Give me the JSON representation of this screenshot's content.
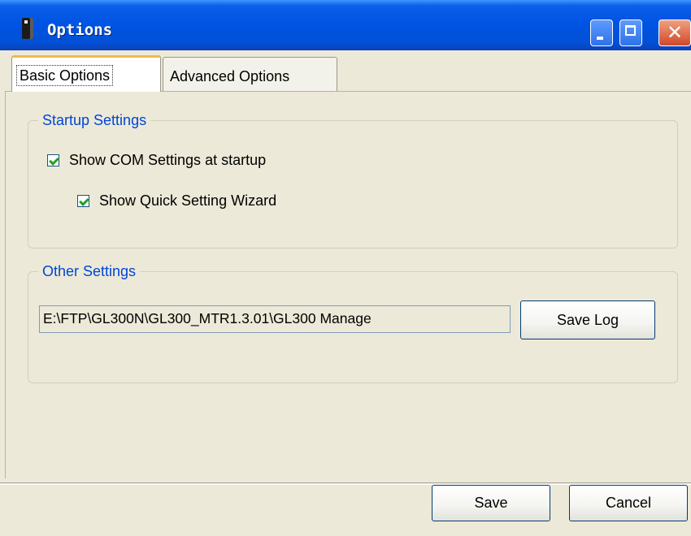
{
  "window": {
    "title": "Options",
    "controls": {
      "minimize": "minimize",
      "maximize": "maximize",
      "close": "close"
    }
  },
  "tabs": [
    {
      "label": "Basic Options",
      "selected": true
    },
    {
      "label": "Advanced Options",
      "selected": false
    }
  ],
  "startup_settings": {
    "legend": "Startup Settings",
    "show_com_settings": {
      "label": "Show COM Settings at startup",
      "checked": true
    },
    "show_quick_wizard": {
      "label": "Show Quick Setting Wizard",
      "checked": true
    }
  },
  "other_settings": {
    "legend": "Other Settings",
    "path_value": "E:\\FTP\\GL300N\\GL300_MTR1.3.01\\GL300 Manage",
    "save_log_label": "Save Log"
  },
  "footer": {
    "save_label": "Save",
    "cancel_label": "Cancel"
  },
  "icons": {
    "app": "application-icon",
    "check": "checkmark-icon"
  },
  "colors": {
    "titlebar": "#0054e3",
    "legend_text": "#0046d5",
    "checkmark": "#21a121",
    "window_bg": "#ece9d8"
  }
}
